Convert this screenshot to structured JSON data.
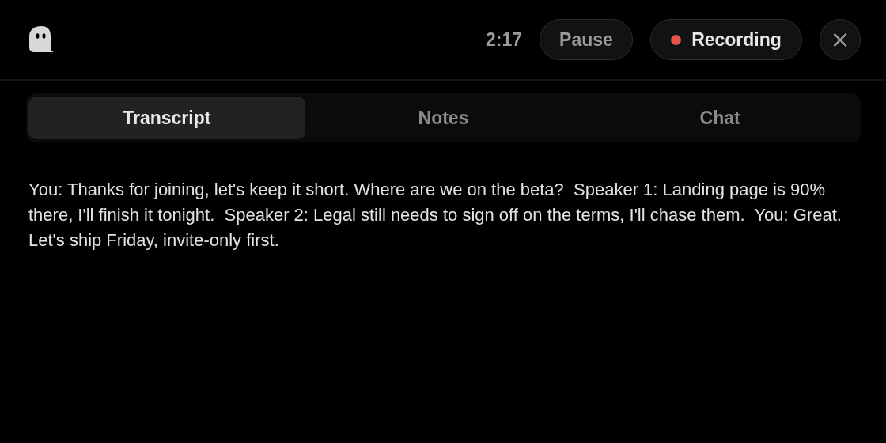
{
  "header": {
    "timer": "2:17",
    "pause_button": {
      "label": "Pause"
    },
    "record_button": {
      "label": "Recording",
      "recording": true
    },
    "close_button": {
      "label": "×"
    }
  },
  "tabs": [
    {
      "label": "Transcript",
      "selected": true
    },
    {
      "label": "Notes",
      "selected": false
    },
    {
      "label": "Chat",
      "selected": false
    }
  ],
  "transcript": {
    "text": "You: Thanks for joining, let's keep it short. Where are we on the beta?  Speaker 1: Landing page is 90% there, I'll finish it tonight.  Speaker 2: Legal still needs to sign off on the terms, I'll chase them.  You: Great. Let's ship Friday, invite-only first."
  }
}
